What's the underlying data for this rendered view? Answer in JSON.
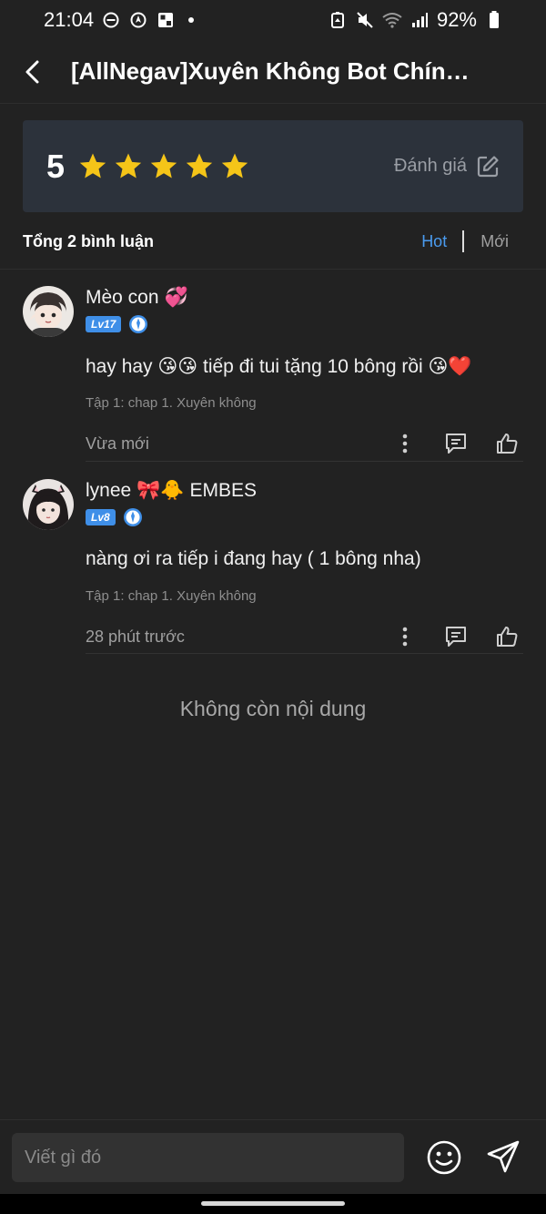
{
  "status_bar": {
    "time": "21:04",
    "battery": "92%",
    "left_icons": [
      "do-not-disturb-icon",
      "location-icon",
      "gallery-icon",
      "dot-icon"
    ],
    "right_icons": [
      "battery-saver-icon",
      "mute-icon",
      "wifi-icon",
      "signal-icon",
      "battery-icon"
    ]
  },
  "header": {
    "title": "[AllNegav]Xuyên Không Bot Chính ...",
    "back_icon": "back-arrow-icon"
  },
  "rating": {
    "score": "5",
    "stars_filled": 5,
    "stars_total": 5,
    "rate_label": "Đánh giá",
    "rate_icon": "edit-icon",
    "star_color": "#f5c518"
  },
  "comments_header": {
    "total_label": "Tổng 2 bình luận",
    "sort_hot": "Hot",
    "sort_new": "Mới",
    "active_color": "#4a9bef"
  },
  "comments": [
    {
      "name": "Mèo con",
      "name_emoji": "💞",
      "level": "Lv17",
      "text": "hay hay 😘😘 tiếp đi tui tặng 10 bông rồi 😘❤️",
      "chapter": "Tập 1: chap 1. Xuyên không",
      "time": "Vừa mới"
    },
    {
      "name": "lynee",
      "name_emoji": "🎀🐥",
      "name_suffix": "EMBES",
      "level": "Lv8",
      "text": "nàng ơi ra tiếp i đang hay ( 1 bông nha)",
      "chapter": "Tập 1: chap 1. Xuyên không",
      "time": "28 phút trước"
    }
  ],
  "end_message": "Không còn nội dung",
  "composer": {
    "placeholder": "Viết gì đó",
    "emoji_icon": "smiley-icon",
    "send_icon": "send-icon"
  },
  "colors": {
    "background": "#222222",
    "card": "#2c323b",
    "level_badge": "#3f8fe8"
  }
}
